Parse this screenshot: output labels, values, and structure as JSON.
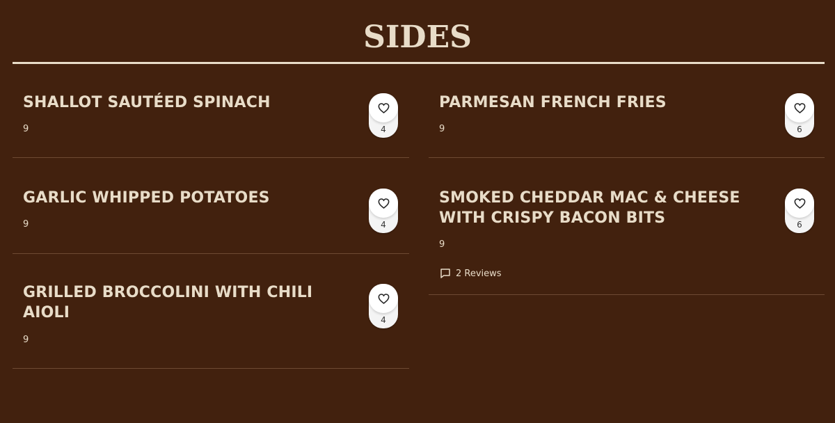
{
  "section": {
    "title": "SIDES"
  },
  "items": [
    {
      "name": "SHALLOT SAUTÉED SPINACH",
      "price": "9",
      "likes": "4"
    },
    {
      "name": "GARLIC WHIPPED POTATOES",
      "price": "9",
      "likes": "4"
    },
    {
      "name_line1": "GRILLED BROCCOLINI WITH CHILI",
      "name_line2": "AIOLI",
      "price": "9",
      "likes": "4"
    },
    {
      "name": "PARMESAN FRENCH FRIES",
      "price": "9",
      "likes": "6"
    },
    {
      "name_line1": "SMOKED CHEDDAR MAC & CHEESE",
      "name_line2": "WITH CRISPY BACON BITS",
      "price": "9",
      "likes": "6",
      "reviews": "2 Reviews"
    }
  ],
  "icons": {
    "like": "heart-icon",
    "reviews": "comment-icon"
  },
  "colors": {
    "background": "#42210e",
    "text": "#e8dcc8",
    "divider": "#6e4a33",
    "like_widget": "#f4f4f4"
  }
}
